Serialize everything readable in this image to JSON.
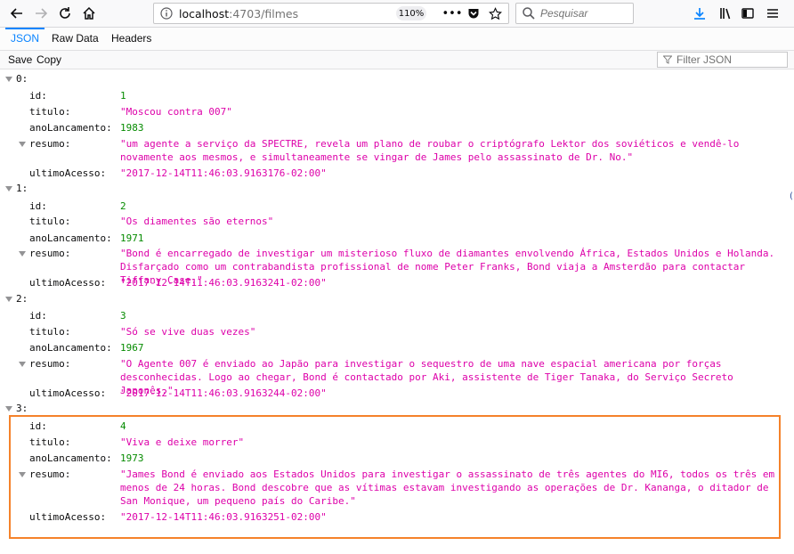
{
  "browser": {
    "url_host": "localhost",
    "url_rest": ":4703/filmes",
    "zoom": "110%",
    "search_placeholder": "Pesquisar"
  },
  "viewer": {
    "tabs": [
      "JSON",
      "Raw Data",
      "Headers"
    ],
    "save_label": "Save",
    "copy_label": "Copy",
    "filter_placeholder": "Filter JSON"
  },
  "items": [
    {
      "index": "0:",
      "id": "1",
      "titulo": "\"Moscou contra 007\"",
      "anoLancamento": "1983",
      "resumo": "\"um agente a serviço da SPECTRE, revela um plano de roubar o criptógrafo Lektor dos soviéticos e vendê-lo novamente aos mesmos, e simultaneamente se vingar de James pelo assassinato de Dr. No.\"",
      "ultimoAcesso": "\"2017-12-14T11:46:03.9163176-02:00\""
    },
    {
      "index": "1:",
      "id": "2",
      "titulo": "\"Os diamentes são eternos\"",
      "anoLancamento": "1971",
      "resumo": "\"Bond é encarregado de investigar um misterioso fluxo de diamantes envolvendo África, Estados Unidos e Holanda. Disfarçado como um contrabandista profissional de nome Peter Franks, Bond viaja a Amsterdão para contactar Tiffany Case.\"",
      "ultimoAcesso": "\"2017-12-14T11:46:03.9163241-02:00\""
    },
    {
      "index": "2:",
      "id": "3",
      "titulo": "\"Só se vive duas vezes\"",
      "anoLancamento": "1967",
      "resumo": "\"O Agente 007 é enviado ao Japão para investigar o sequestro de uma nave espacial americana por forças desconhecidas. Logo ao chegar, Bond é contactado por Aki, assistente de Tiger Tanaka, do Serviço Secreto Japonês.\"",
      "ultimoAcesso": "\"2017-12-14T11:46:03.9163244-02:00\""
    },
    {
      "index": "3:",
      "id": "4",
      "titulo": "\"Viva e deixe morrer\"",
      "anoLancamento": "1973",
      "resumo": "\"James Bond é enviado aos Estados Unidos para investigar o assassinato de três agentes do MI6, todos os três em menos de 24 horas. Bond descobre que as vítimas estavam investigando as operações de Dr. Kananga, o ditador de San Monique, um pequeno país do Caribe.\"",
      "ultimoAcesso": "\"2017-12-14T11:46:03.9163251-02:00\""
    }
  ],
  "keys": {
    "id": "id:",
    "titulo": "titulo:",
    "anoLancamento": "anoLancamento:",
    "resumo": "resumo:",
    "ultimoAcesso": "ultimoAcesso:"
  },
  "colors": {
    "string": "#dd00a9",
    "number": "#058b00",
    "highlight": "#f5822a",
    "accent": "#0a84ff"
  }
}
